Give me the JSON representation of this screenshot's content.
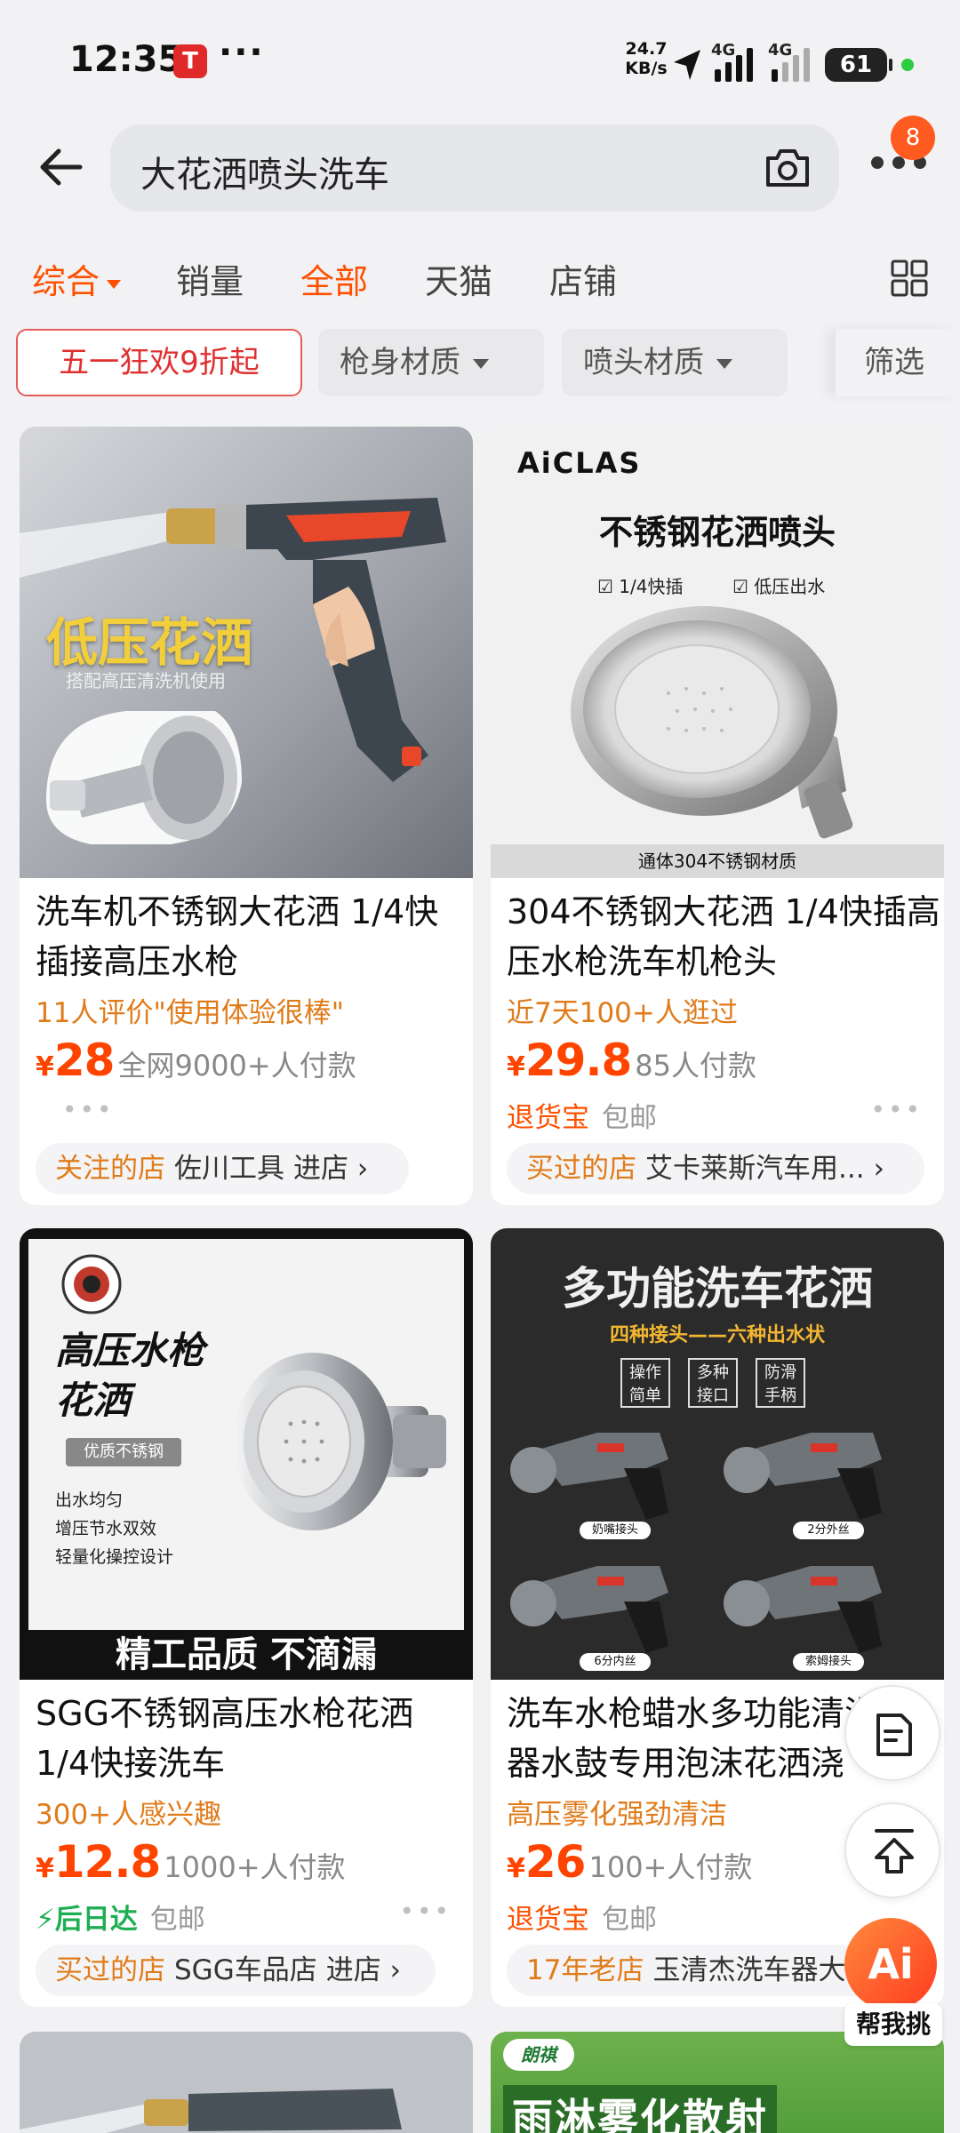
{
  "status_bar": {
    "time": "12:35",
    "app_icon": "tesla-icon",
    "more": "···",
    "net_speed_value": "24.7",
    "net_speed_unit": "KB/s",
    "signal_1": "4G",
    "signal_2": "4G",
    "battery": "61"
  },
  "search": {
    "query": "大花洒喷头洗车",
    "icons": [
      "back-arrow-icon",
      "camera-icon",
      "more-dots-icon"
    ],
    "more_badge": "8"
  },
  "sort_tabs": {
    "comprehensive": "综合",
    "sales": "销量",
    "all": "全部",
    "tmall": "天猫",
    "store": "店铺",
    "layout_icon": "grid-icon"
  },
  "filters": {
    "promo": "五一狂欢9折起",
    "gun_material": "枪身材质",
    "nozzle_material": "喷头材质",
    "filter": "筛选"
  },
  "products": [
    {
      "image_text": "低压花洒",
      "image_subtext": "搭配高压清洗机使用",
      "title": "洗车机不锈钢大花洒 1/4快插接高压水枪",
      "subtitle": "11人评价\"使用体验很棒\"",
      "currency": "¥",
      "price": "28",
      "sold": "全网9000+人付款",
      "shop_tag": "关注的店",
      "shop_name": "佐川工具",
      "shop_enter": "进店 ›"
    },
    {
      "image_brand": "AiCLAS",
      "image_text": "不锈钢花洒喷头",
      "image_feature_1": "☑ 1/4快插",
      "image_feature_2": "☑ 低压出水",
      "image_footer": "通体304不锈钢材质",
      "title": "304不锈钢大花洒 1/4快插高压水枪洗车机枪头",
      "subtitle": "近7天100+人逛过",
      "currency": "¥",
      "price": "29.8",
      "sold": "85人付款",
      "service_1": "退货宝",
      "service_2": "包邮",
      "shop_tag": "买过的店",
      "shop_name": "艾卡莱斯汽车用...",
      "shop_enter": "›"
    },
    {
      "image_text": "高压水枪\n花洒",
      "image_tag": "优质不锈钢",
      "image_points": [
        "出水均匀",
        "增压节水双效",
        "轻量化操控设计"
      ],
      "image_footer": "精工品质 不滴漏",
      "title": "SGG不锈钢高压水枪花洒 1/4快接洗车",
      "subtitle": "300+人感兴趣",
      "currency": "¥",
      "price": "12.8",
      "sold": "1000+人付款",
      "service_1": "后日达",
      "service_2": "包邮",
      "shop_tag": "买过的店",
      "shop_name": "SGG车品店",
      "shop_enter": "进店 ›"
    },
    {
      "image_text": "多功能洗车花洒",
      "image_subtext": "四种接头——六种出水状",
      "image_boxes": [
        "操作简单",
        "多种接口",
        "防滑手柄"
      ],
      "image_labels": [
        "奶嘴接头",
        "2分外丝",
        "6分内丝",
        "索姆接头"
      ],
      "title": "洗车水枪蜡水多功能清洗神器水鼓专用泡沫花洒浇",
      "subtitle": "高压雾化强劲清洁",
      "currency": "¥",
      "price": "26",
      "sold": "100+人付款",
      "service_1": "退货宝",
      "service_2": "包邮",
      "shop_tag": "17年老店",
      "shop_name": "玉清杰洗车器大",
      "shop_enter": ""
    },
    {
      "image_text": ""
    },
    {
      "image_brand": "朗祺",
      "image_text": "雨淋雾化散射"
    }
  ],
  "floating": {
    "feedback_icon": "edit-note-icon",
    "top_icon": "back-to-top-icon",
    "ai_button": "Ai",
    "ai_label": "帮我挑"
  }
}
